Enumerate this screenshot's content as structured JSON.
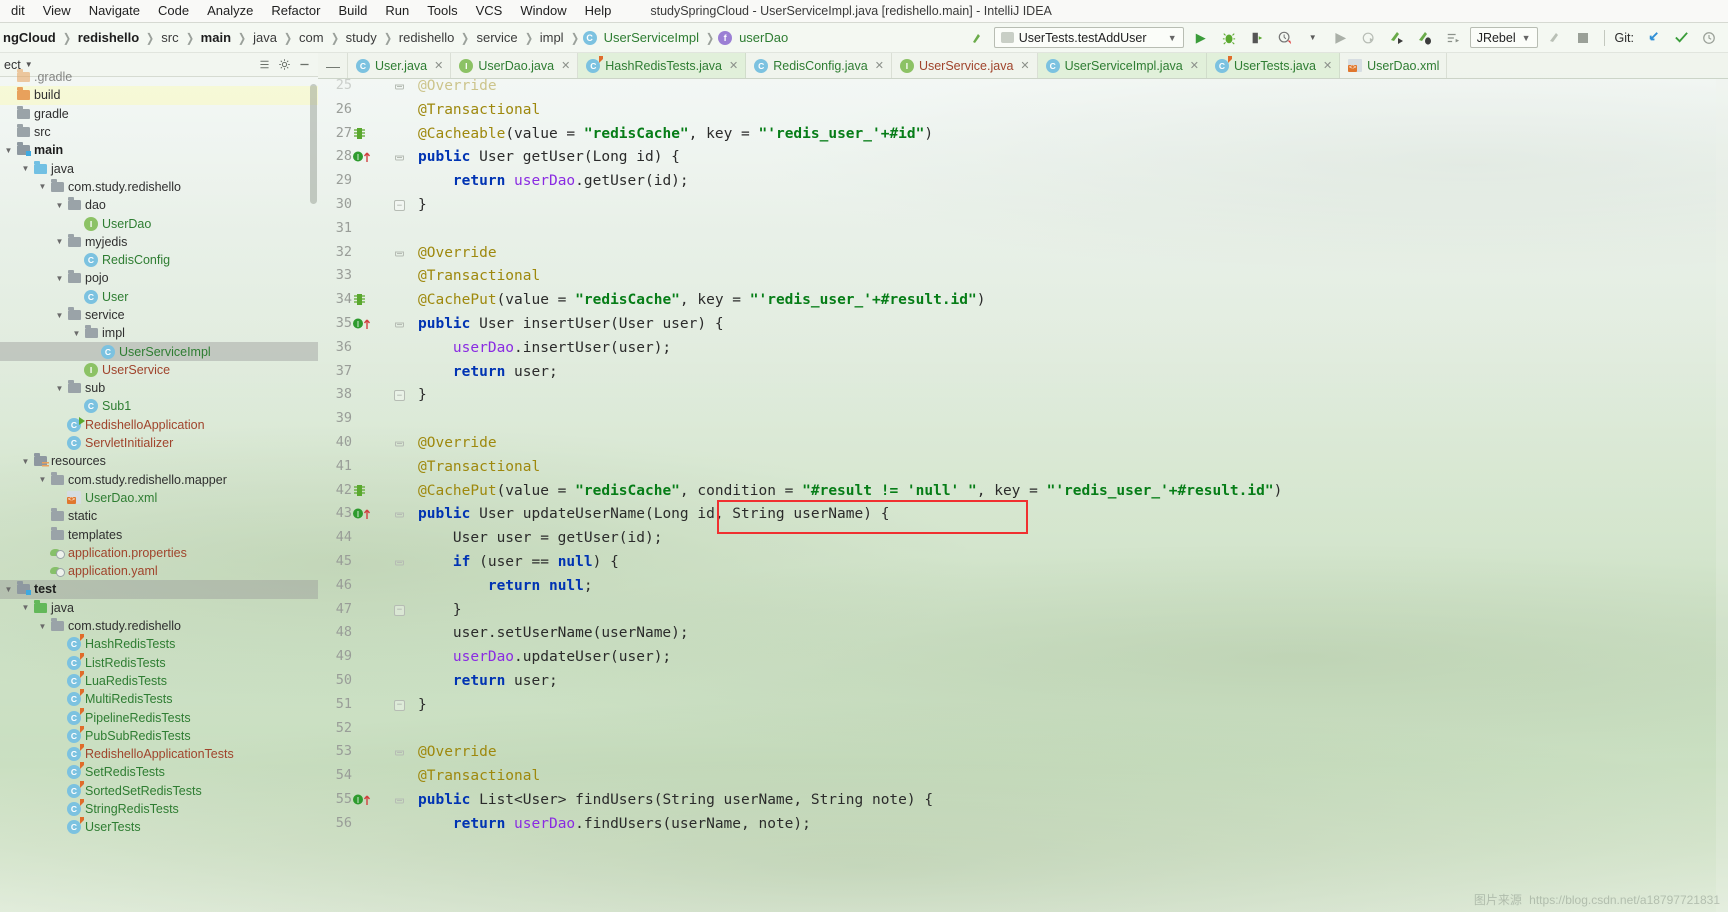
{
  "window": {
    "title": "studySpringCloud - UserServiceImpl.java [redishello.main] - IntelliJ IDEA"
  },
  "menubar": {
    "items": [
      {
        "label": "dit"
      },
      {
        "label": "View"
      },
      {
        "label": "Navigate"
      },
      {
        "label": "Code"
      },
      {
        "label": "Analyze"
      },
      {
        "label": "Refactor"
      },
      {
        "label": "Build"
      },
      {
        "label": "Run"
      },
      {
        "label": "Tools"
      },
      {
        "label": "VCS"
      },
      {
        "label": "Window"
      },
      {
        "label": "Help"
      }
    ]
  },
  "breadcrumb": {
    "items": [
      {
        "label": "ngCloud",
        "style": "bold"
      },
      {
        "label": "redishello",
        "style": "bold"
      },
      {
        "label": "src",
        "style": "normal"
      },
      {
        "label": "main",
        "style": "bold"
      },
      {
        "label": "java",
        "style": "normal"
      },
      {
        "label": "com",
        "style": "normal"
      },
      {
        "label": "study",
        "style": "normal"
      },
      {
        "label": "redishello",
        "style": "normal"
      },
      {
        "label": "service",
        "style": "normal"
      },
      {
        "label": "impl",
        "style": "normal"
      },
      {
        "label": "UserServiceImpl",
        "style": "class"
      },
      {
        "label": "userDao",
        "style": "field"
      }
    ]
  },
  "toolbar": {
    "run_config": "UserTests.testAddUser",
    "jrebel_label": "JRebel",
    "git_label": "Git:",
    "icons": [
      "build-arrow-icon",
      "run-icon",
      "debug-icon",
      "run-with-coverage-icon",
      "profile-icon",
      "rerun-icon",
      "stop-icon",
      "attach-debugger-icon",
      "jrebel-run-icon",
      "jrebel-debug-icon",
      "run-dashboard-icon",
      "update-project-icon",
      "commit-icon",
      "history-icon"
    ]
  },
  "project_panel": {
    "title": "ect",
    "toolbar_icons": [
      "collapse-icon",
      "settings-icon",
      "hide-icon"
    ],
    "tree": [
      {
        "depth": 1,
        "label": ".gradle",
        "icon": "folder-orange",
        "arrow": "none",
        "color": "normal",
        "state": "clipped"
      },
      {
        "depth": 1,
        "label": "build",
        "icon": "folder-orange",
        "arrow": "none",
        "color": "normal",
        "state": "highlight"
      },
      {
        "depth": 1,
        "label": "gradle",
        "icon": "folder-gray",
        "arrow": "none",
        "color": "normal",
        "state": "none"
      },
      {
        "depth": 1,
        "label": "src",
        "icon": "folder-gray",
        "arrow": "none",
        "color": "normal",
        "state": "none"
      },
      {
        "depth": 1,
        "label": "main",
        "icon": "folder-src",
        "arrow": "open",
        "color": "bold",
        "state": "none"
      },
      {
        "depth": 2,
        "label": "java",
        "icon": "folder-blue",
        "arrow": "open",
        "color": "normal",
        "state": "none"
      },
      {
        "depth": 3,
        "label": "com.study.redishello",
        "icon": "folder-pkg",
        "arrow": "open",
        "color": "normal",
        "state": "none"
      },
      {
        "depth": 4,
        "label": "dao",
        "icon": "folder-pkg",
        "arrow": "open",
        "color": "normal",
        "state": "none"
      },
      {
        "depth": 5,
        "label": "UserDao",
        "icon": "interface",
        "arrow": "none",
        "color": "green",
        "state": "none"
      },
      {
        "depth": 4,
        "label": "myjedis",
        "icon": "folder-pkg",
        "arrow": "open",
        "color": "normal",
        "state": "none"
      },
      {
        "depth": 5,
        "label": "RedisConfig",
        "icon": "class",
        "arrow": "none",
        "color": "green",
        "state": "none"
      },
      {
        "depth": 4,
        "label": "pojo",
        "icon": "folder-pkg",
        "arrow": "open",
        "color": "normal",
        "state": "none"
      },
      {
        "depth": 5,
        "label": "User",
        "icon": "class",
        "arrow": "none",
        "color": "green",
        "state": "none"
      },
      {
        "depth": 4,
        "label": "service",
        "icon": "folder-pkg",
        "arrow": "open",
        "color": "normal",
        "state": "none"
      },
      {
        "depth": 5,
        "label": "impl",
        "icon": "folder-pkg",
        "arrow": "open",
        "color": "normal",
        "state": "none"
      },
      {
        "depth": 6,
        "label": "UserServiceImpl",
        "icon": "class",
        "arrow": "none",
        "color": "green",
        "state": "selected"
      },
      {
        "depth": 5,
        "label": "UserService",
        "icon": "interface",
        "arrow": "none",
        "color": "red",
        "state": "none"
      },
      {
        "depth": 4,
        "label": "sub",
        "icon": "folder-pkg",
        "arrow": "open",
        "color": "normal",
        "state": "none"
      },
      {
        "depth": 5,
        "label": "Sub1",
        "icon": "class",
        "arrow": "none",
        "color": "green",
        "state": "none"
      },
      {
        "depth": 4,
        "label": "RedishelloApplication",
        "icon": "class-run",
        "arrow": "none",
        "color": "red",
        "state": "none"
      },
      {
        "depth": 4,
        "label": "ServletInitializer",
        "icon": "class",
        "arrow": "none",
        "color": "red",
        "state": "none"
      },
      {
        "depth": 2,
        "label": "resources",
        "icon": "folder-res",
        "arrow": "open",
        "color": "normal",
        "state": "none"
      },
      {
        "depth": 3,
        "label": "com.study.redishello.mapper",
        "icon": "folder-gray",
        "arrow": "open",
        "color": "normal",
        "state": "none"
      },
      {
        "depth": 4,
        "label": "UserDao.xml",
        "icon": "xml",
        "arrow": "none",
        "color": "green",
        "state": "none"
      },
      {
        "depth": 3,
        "label": "static",
        "icon": "folder-gray",
        "arrow": "none",
        "color": "normal",
        "state": "none"
      },
      {
        "depth": 3,
        "label": "templates",
        "icon": "folder-gray",
        "arrow": "none",
        "color": "normal",
        "state": "none"
      },
      {
        "depth": 3,
        "label": "application.properties",
        "icon": "properties",
        "arrow": "none",
        "color": "red",
        "state": "none"
      },
      {
        "depth": 3,
        "label": "application.yaml",
        "icon": "properties",
        "arrow": "none",
        "color": "red",
        "state": "none"
      },
      {
        "depth": 1,
        "label": "test",
        "icon": "folder-test",
        "arrow": "open",
        "color": "bold",
        "state": "selected"
      },
      {
        "depth": 2,
        "label": "java",
        "icon": "folder-green",
        "arrow": "open",
        "color": "normal",
        "state": "none"
      },
      {
        "depth": 3,
        "label": "com.study.redishello",
        "icon": "folder-pkg",
        "arrow": "open",
        "color": "normal",
        "state": "none"
      },
      {
        "depth": 4,
        "label": "HashRedisTests",
        "icon": "class-test",
        "arrow": "none",
        "color": "green",
        "state": "none"
      },
      {
        "depth": 4,
        "label": "ListRedisTests",
        "icon": "class-test",
        "arrow": "none",
        "color": "green",
        "state": "none"
      },
      {
        "depth": 4,
        "label": "LuaRedisTests",
        "icon": "class-test",
        "arrow": "none",
        "color": "green",
        "state": "none"
      },
      {
        "depth": 4,
        "label": "MultiRedisTests",
        "icon": "class-test",
        "arrow": "none",
        "color": "green",
        "state": "none"
      },
      {
        "depth": 4,
        "label": "PipelineRedisTests",
        "icon": "class-test",
        "arrow": "none",
        "color": "green",
        "state": "none"
      },
      {
        "depth": 4,
        "label": "PubSubRedisTests",
        "icon": "class-test",
        "arrow": "none",
        "color": "green",
        "state": "none"
      },
      {
        "depth": 4,
        "label": "RedishelloApplicationTests",
        "icon": "class-test",
        "arrow": "none",
        "color": "red",
        "state": "none"
      },
      {
        "depth": 4,
        "label": "SetRedisTests",
        "icon": "class-test",
        "arrow": "none",
        "color": "green",
        "state": "none"
      },
      {
        "depth": 4,
        "label": "SortedSetRedisTests",
        "icon": "class-test",
        "arrow": "none",
        "color": "green",
        "state": "none"
      },
      {
        "depth": 4,
        "label": "StringRedisTests",
        "icon": "class-test",
        "arrow": "none",
        "color": "green",
        "state": "none"
      },
      {
        "depth": 4,
        "label": "UserTests",
        "icon": "class-test",
        "arrow": "none",
        "color": "green",
        "state": "none"
      }
    ]
  },
  "editor_tabs": [
    {
      "label": "User.java",
      "icon": "class",
      "active": false,
      "color": "green"
    },
    {
      "label": "UserDao.java",
      "icon": "interface",
      "active": false,
      "color": "green"
    },
    {
      "label": "HashRedisTests.java",
      "icon": "class-test",
      "active": true,
      "color": "green"
    },
    {
      "label": "RedisConfig.java",
      "icon": "class",
      "active": false,
      "color": "green"
    },
    {
      "label": "UserService.java",
      "icon": "interface",
      "active": false,
      "color": "red"
    },
    {
      "label": "UserServiceImpl.java",
      "icon": "class",
      "active": true,
      "color": "green"
    },
    {
      "label": "UserTests.java",
      "icon": "class-test",
      "active": true,
      "color": "green"
    },
    {
      "label": "UserDao.xml",
      "icon": "xml",
      "active": false,
      "color": "green"
    }
  ],
  "code": {
    "first_line_number": 25,
    "lines": [
      {
        "n": 25,
        "text": "@Override",
        "clipped": true
      },
      {
        "n": 26,
        "text": "@Transactional"
      },
      {
        "n": 27,
        "text": "@Cacheable(value = \"redisCache\", key = \"'redis_user_'+#id\")",
        "gutter": "bookmark"
      },
      {
        "n": 28,
        "text": "public User getUser(Long id) {",
        "gutter": "override"
      },
      {
        "n": 29,
        "text": "    return userDao.getUser(id);"
      },
      {
        "n": 30,
        "text": "}"
      },
      {
        "n": 31,
        "text": ""
      },
      {
        "n": 32,
        "text": "@Override"
      },
      {
        "n": 33,
        "text": "@Transactional"
      },
      {
        "n": 34,
        "text": "@CachePut(value = \"redisCache\", key = \"'redis_user_'+#result.id\")",
        "gutter": "bookmark"
      },
      {
        "n": 35,
        "text": "public User insertUser(User user) {",
        "gutter": "override"
      },
      {
        "n": 36,
        "text": "    userDao.insertUser(user);"
      },
      {
        "n": 37,
        "text": "    return user;"
      },
      {
        "n": 38,
        "text": "}"
      },
      {
        "n": 39,
        "text": ""
      },
      {
        "n": 40,
        "text": "@Override"
      },
      {
        "n": 41,
        "text": "@Transactional"
      },
      {
        "n": 42,
        "text": "@CachePut(value = \"redisCache\", condition = \"#result != 'null' \", key = \"'redis_user_'+#result.id\")",
        "gutter": "bookmark"
      },
      {
        "n": 43,
        "text": "public User updateUserName(Long id, String userName) {",
        "gutter": "override"
      },
      {
        "n": 44,
        "text": "    User user = getUser(id);"
      },
      {
        "n": 45,
        "text": "    if (user == null) {"
      },
      {
        "n": 46,
        "text": "        return null;"
      },
      {
        "n": 47,
        "text": "    }"
      },
      {
        "n": 48,
        "text": "    user.setUserName(userName);"
      },
      {
        "n": 49,
        "text": "    userDao.updateUser(user);"
      },
      {
        "n": 50,
        "text": "    return user;"
      },
      {
        "n": 51,
        "text": "}"
      },
      {
        "n": 52,
        "text": ""
      },
      {
        "n": 53,
        "text": "@Override"
      },
      {
        "n": 54,
        "text": "@Transactional"
      },
      {
        "n": 55,
        "text": "public List<User> findUsers(String userName, String note) {",
        "gutter": "override"
      },
      {
        "n": 56,
        "text": "    return userDao.findUsers(userName, note);"
      }
    ],
    "annotation_highlight": "condition = \"#result != 'null' \","
  },
  "watermark": {
    "cn_text": "图片来源",
    "url_text": "https://blog.csdn.net/a18797721831"
  }
}
